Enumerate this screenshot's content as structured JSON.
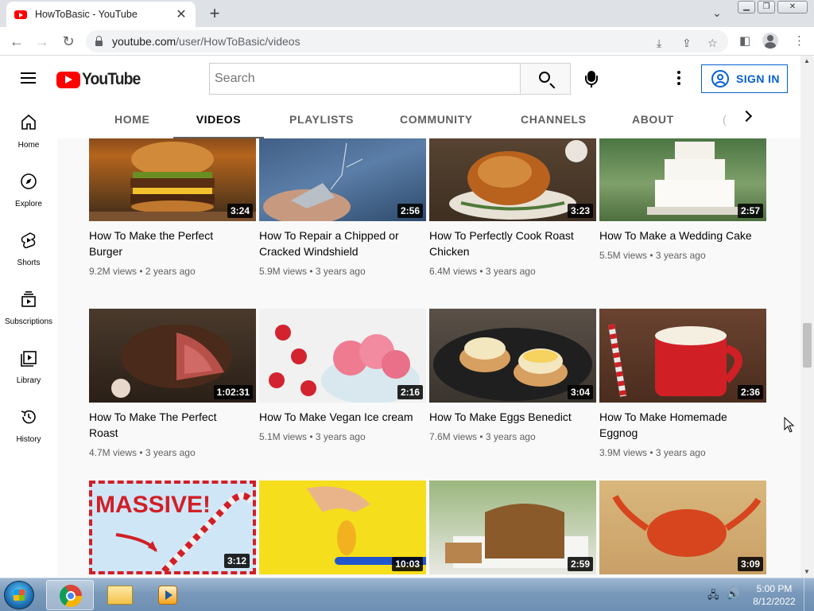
{
  "browser": {
    "tab_title": "HowToBasic - YouTube",
    "tab_close": "✕",
    "new_tab": "+",
    "url_host": "youtube.com",
    "url_path": "/user/HowToBasic/videos"
  },
  "masthead": {
    "logo_text": "YouTube",
    "search_placeholder": "Search",
    "sign_in_label": "SIGN IN"
  },
  "guide": {
    "items": [
      {
        "label": "Home",
        "icon": "home-icon"
      },
      {
        "label": "Explore",
        "icon": "compass-icon"
      },
      {
        "label": "Shorts",
        "icon": "shorts-icon"
      },
      {
        "label": "Subscriptions",
        "icon": "subscriptions-icon"
      },
      {
        "label": "Library",
        "icon": "library-icon"
      },
      {
        "label": "History",
        "icon": "history-icon"
      }
    ]
  },
  "channel_tabs": {
    "items": [
      "HOME",
      "VIDEOS",
      "PLAYLISTS",
      "COMMUNITY",
      "CHANNELS",
      "ABOUT"
    ],
    "active": "VIDEOS"
  },
  "videos": [
    {
      "title": "How To Make the Perfect Burger",
      "duration": "3:24",
      "views": "9.2M views",
      "age": "2 years ago"
    },
    {
      "title": "How To Repair a Chipped or Cracked Windshield",
      "duration": "2:56",
      "views": "5.9M views",
      "age": "3 years ago"
    },
    {
      "title": "How To Perfectly Cook Roast Chicken",
      "duration": "3:23",
      "views": "6.4M views",
      "age": "3 years ago"
    },
    {
      "title": "How To Make a Wedding Cake",
      "duration": "2:57",
      "views": "5.5M views",
      "age": "3 years ago"
    },
    {
      "title": "How To Make The Perfect Roast",
      "duration": "1:02:31",
      "views": "4.7M views",
      "age": "3 years ago"
    },
    {
      "title": "How To Make Vegan Ice cream",
      "duration": "2:16",
      "views": "5.1M views",
      "age": "3 years ago"
    },
    {
      "title": "How To Make Eggs Benedict",
      "duration": "3:04",
      "views": "7.6M views",
      "age": "3 years ago"
    },
    {
      "title": "How To Make Homemade Eggnog",
      "duration": "2:36",
      "views": "3.9M views",
      "age": "3 years ago"
    },
    {
      "title": "",
      "duration": "3:12",
      "views": "",
      "age": "",
      "thumb_text": "MASSIVE!"
    },
    {
      "title": "",
      "duration": "10:03",
      "views": "",
      "age": ""
    },
    {
      "title": "",
      "duration": "2:59",
      "views": "",
      "age": ""
    },
    {
      "title": "",
      "duration": "3:09",
      "views": "",
      "age": ""
    }
  ],
  "taskbar": {
    "time": "5:00 PM",
    "date": "8/12/2022"
  },
  "colors": {
    "accent": "#065fd4",
    "brand_red": "#ff0000"
  }
}
